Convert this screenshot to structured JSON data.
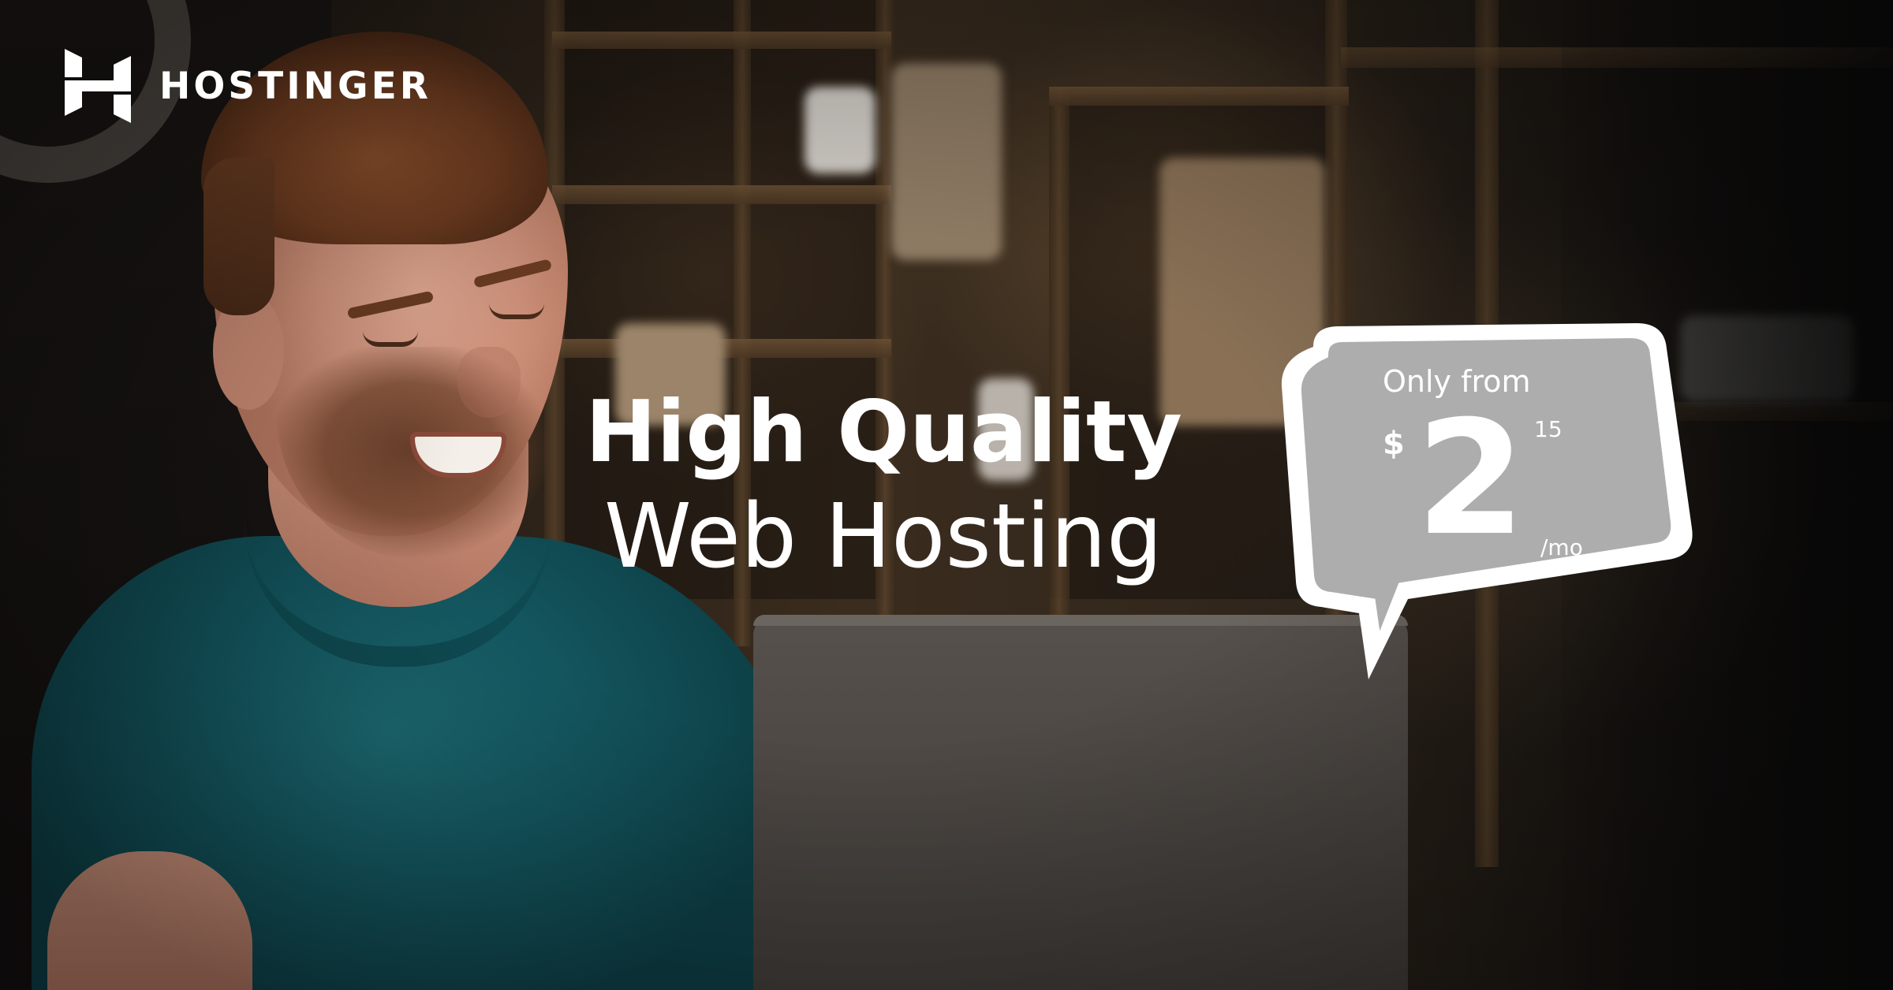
{
  "brand": {
    "name": "HOSTINGER",
    "logo_icon": "hostinger-h-icon"
  },
  "headline": {
    "line1": "High Quality",
    "line2": "Web Hosting"
  },
  "price_bubble": {
    "prefix": "Only from",
    "currency": "$",
    "amount": "2",
    "cents": "15",
    "period": "/mo"
  },
  "colors": {
    "text": "#ffffff",
    "shirt": "#145760"
  }
}
